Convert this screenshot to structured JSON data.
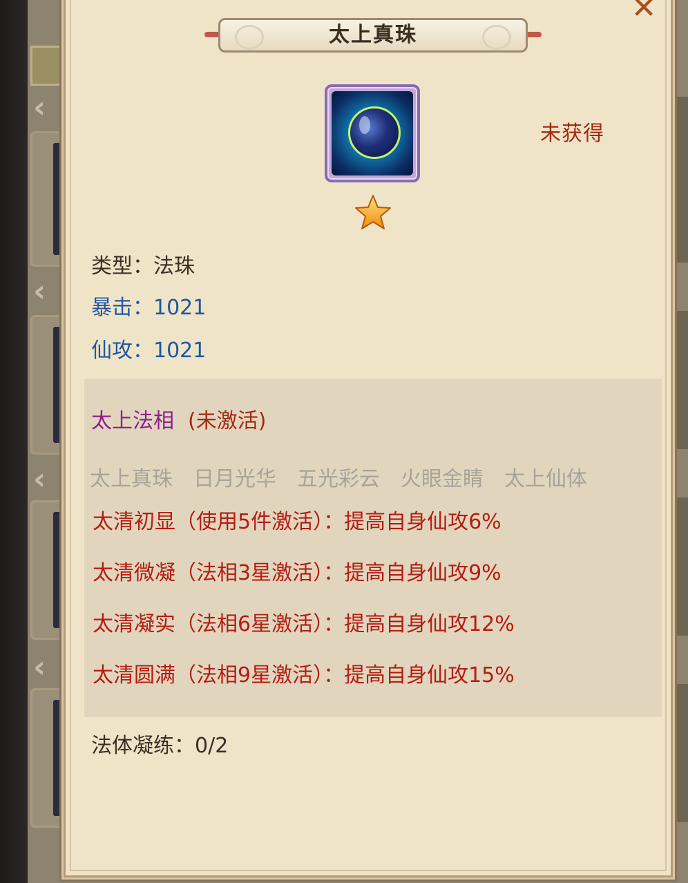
{
  "dialog": {
    "title": "太上真珠",
    "close_icon": "close-icon",
    "status": "未获得",
    "star_count": 1
  },
  "item": {
    "icon": "blue-pearl-orb-icon",
    "type_label": "类型：",
    "type_value": "法珠",
    "stats": [
      {
        "label": "暴击：",
        "value": "1021"
      },
      {
        "label": "仙攻：",
        "value": "1021"
      }
    ]
  },
  "set": {
    "name": "太上法相",
    "state": "(未激活)",
    "members": [
      "太上真珠",
      "日月光华",
      "五光彩云",
      "火眼金睛",
      "太上仙体"
    ],
    "bonuses": [
      "太清初显（使用5件激活）：提高自身仙攻6%",
      "太清微凝（法相3星激活）：提高自身仙攻9%",
      "太清凝实（法相6星激活）：提高自身仙攻12%",
      "太清圆满（法相9星激活）：提高自身仙攻15%"
    ]
  },
  "refine": {
    "label": "法体凝练：",
    "value": "0/2"
  },
  "colors": {
    "panel_bg": "#f0e4c8",
    "set_box_bg": "#e1d6bd",
    "stat_blue": "#1d57a3",
    "bonus_red": "#b41c14",
    "set_name_purple": "#8d1f90",
    "member_gray": "#a8a39a"
  }
}
